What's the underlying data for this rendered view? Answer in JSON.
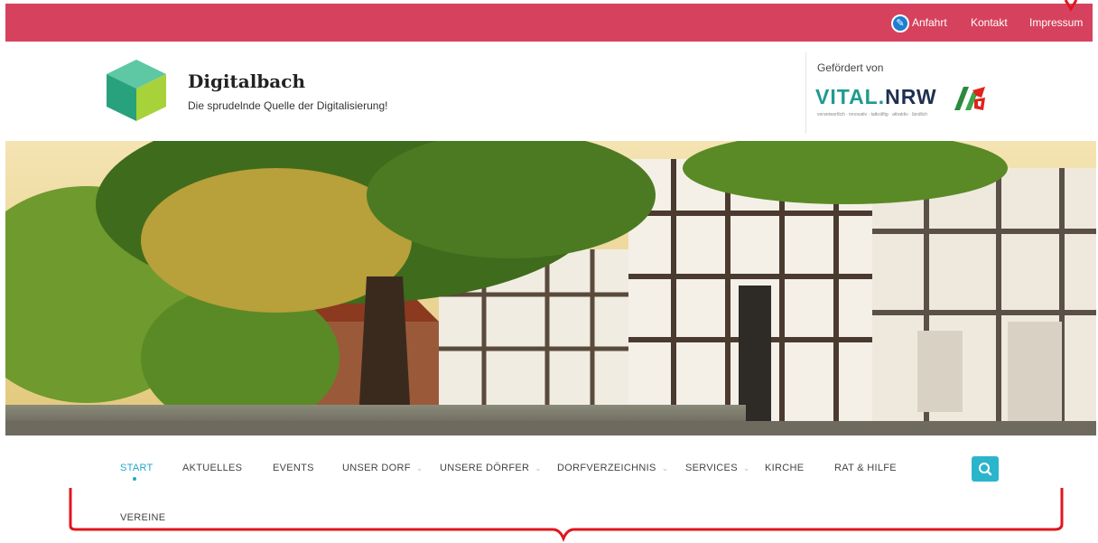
{
  "topbar": {
    "links": [
      {
        "label": "Anfahrt"
      },
      {
        "label": "Kontakt"
      },
      {
        "label": "Impressum"
      }
    ],
    "edit_icon": "pencil-icon"
  },
  "header": {
    "title": "Digitalbach",
    "tagline": "Die sprudelnde Quelle der Digitalisierung!",
    "logo_icon": "cube-logo-icon",
    "sponsor": {
      "label": "Gefördert von",
      "brand_part1": "VITAL.",
      "brand_part2": "NRW",
      "brand_sub": "verantwortlich · innovativ · tatkräftig · attraktiv · ländlich"
    }
  },
  "nav": {
    "items": [
      {
        "label": "START",
        "active": true
      },
      {
        "label": "AKTUELLES"
      },
      {
        "label": "EVENTS"
      },
      {
        "label": "UNSER DORF",
        "has_dropdown": true
      },
      {
        "label": "UNSERE DÖRFER",
        "has_dropdown": true
      },
      {
        "label": "DORFVERZEICHNIS",
        "has_dropdown": true
      },
      {
        "label": "SERVICES",
        "has_dropdown": true
      },
      {
        "label": "KIRCHE"
      },
      {
        "label": "RAT & HILFE"
      },
      {
        "label": "VEREINE"
      }
    ],
    "search_icon": "search-icon",
    "caret": "⌄"
  },
  "colors": {
    "topbar": "#d6425e",
    "accent": "#23a6c8",
    "search_button": "#2bb5cc",
    "annotation": "#e0161e"
  }
}
